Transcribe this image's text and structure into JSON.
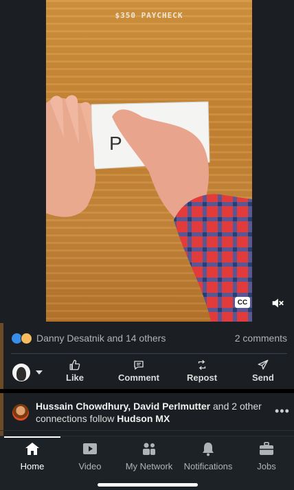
{
  "video": {
    "caption": "$350 PAYCHECK",
    "envelope_text": "P",
    "cc_label": "CC"
  },
  "post": {
    "reactions_text": "Danny Desatnik and 14 others",
    "comments_text": "2 comments"
  },
  "actions": {
    "like": "Like",
    "comment": "Comment",
    "repost": "Repost",
    "send": "Send"
  },
  "suggestion": {
    "names": "Hussain Chowdhury, David Perlmutter",
    "connector": " and 2 other connections follow ",
    "company": "Hudson MX",
    "more": "•••"
  },
  "tabs": [
    {
      "label": "Home",
      "icon": "home-icon",
      "active": true
    },
    {
      "label": "Video",
      "icon": "video-icon"
    },
    {
      "label": "My Network",
      "icon": "network-icon"
    },
    {
      "label": "Notifications",
      "icon": "bell-icon"
    },
    {
      "label": "Jobs",
      "icon": "briefcase-icon"
    }
  ],
  "colors": {
    "background": "#1b1f23",
    "like_blue": "#378fe9",
    "insight_yellow": "#f5bb5c"
  }
}
